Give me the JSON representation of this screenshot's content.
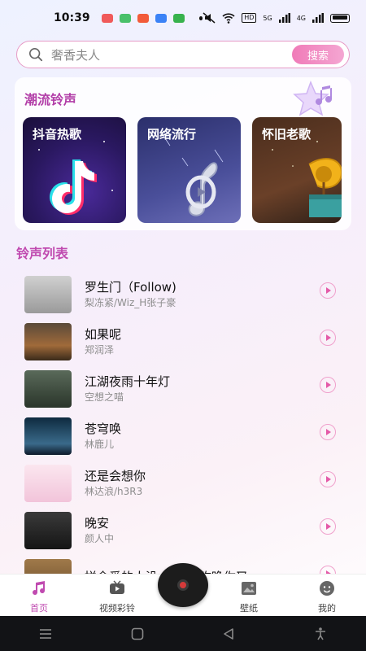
{
  "status_bar": {
    "time": "10:39",
    "hd_label": "HD",
    "signal_1": "5G",
    "signal_2": "4G"
  },
  "search": {
    "placeholder": "奢香夫人",
    "button_label": "搜索"
  },
  "trending": {
    "title": "潮流铃声",
    "categories": [
      {
        "label": "抖音热歌",
        "icon": "tiktok-note-icon"
      },
      {
        "label": "网络流行",
        "icon": "music-note-icon"
      },
      {
        "label": "怀旧老歌",
        "icon": "gramophone-icon"
      }
    ]
  },
  "ringtones": {
    "title": "铃声列表",
    "items": [
      {
        "name": "罗生门（Follow)",
        "artist": "梨冻紧/Wiz_H张子豪",
        "cover_color": "#b5b5b5"
      },
      {
        "name": "如果呢",
        "artist": "郑润泽",
        "cover_color": "#7a5a3a"
      },
      {
        "name": "江湖夜雨十年灯",
        "artist": "空想之喵",
        "cover_color": "#3a4a3a"
      },
      {
        "name": "苍穹唤",
        "artist": "林鹿儿",
        "cover_color": "#1f3a4f"
      },
      {
        "name": "还是会想你",
        "artist": "林达浪/h3R3",
        "cover_color": "#f2d2e4"
      },
      {
        "name": "晚安",
        "artist": "颜人中",
        "cover_color": "#2a2a2a"
      },
      {
        "name": "拼命爱的人没…我赢(昨晚你又",
        "artist": "",
        "cover_color": "#8a6a3a"
      }
    ]
  },
  "tabs": [
    {
      "label": "首页",
      "icon": "home-music-icon",
      "active": true
    },
    {
      "label": "视频彩铃",
      "icon": "video-icon",
      "active": false
    },
    {
      "label": "壁纸",
      "icon": "wallpaper-icon",
      "active": false
    },
    {
      "label": "我的",
      "icon": "profile-icon",
      "active": false
    }
  ],
  "colors": {
    "accent": "#c04ab0",
    "search_button": "#f07bb8",
    "nav_bar": "#121316"
  }
}
